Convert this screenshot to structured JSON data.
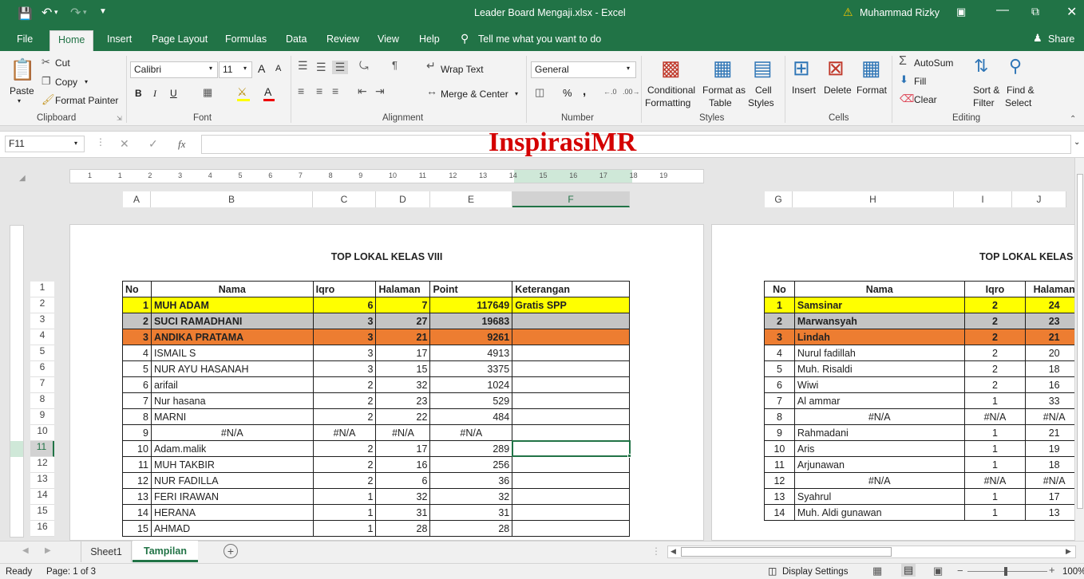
{
  "title": {
    "text": "Leader Board Mengaji.xlsx - Excel",
    "user": "Muhammad Rizky"
  },
  "tabs": [
    "File",
    "Home",
    "Insert",
    "Page Layout",
    "Formulas",
    "Data",
    "Review",
    "View",
    "Help"
  ],
  "tell_me": "Tell me what you want to do",
  "share": "Share",
  "clipboard": {
    "paste": "Paste",
    "cut": "Cut",
    "copy": "Copy",
    "format_painter": "Format Painter",
    "label": "Clipboard"
  },
  "font": {
    "name": "Calibri",
    "size": "11",
    "label": "Font",
    "bold": "B",
    "italic": "I",
    "underline": "U",
    "grow": "A",
    "shrink": "A"
  },
  "alignment": {
    "wrap": "Wrap Text",
    "merge": "Merge & Center",
    "label": "Alignment"
  },
  "number": {
    "format": "General",
    "label": "Number",
    "percent": "%",
    "comma": ","
  },
  "styles": {
    "conditional": "Conditional",
    "formatting": "Formatting",
    "format_as": "Format as",
    "table": "Table",
    "cell": "Cell",
    "cell_styles": "Styles",
    "label": "Styles"
  },
  "cells": {
    "insert": "Insert",
    "delete": "Delete",
    "format": "Format",
    "label": "Cells"
  },
  "editing": {
    "autosum": "AutoSum",
    "fill": "Fill",
    "clear": "Clear",
    "sort": "Sort &",
    "filter": "Filter",
    "find": "Find &",
    "select": "Select",
    "label": "Editing"
  },
  "formula": {
    "namebox": "F11",
    "fx": "fx",
    "watermark": "InspirasiMR"
  },
  "ruler_numbers": [
    "1",
    "1",
    "2",
    "3",
    "4",
    "5",
    "6",
    "7",
    "8",
    "9",
    "10",
    "11",
    "12",
    "13",
    "14",
    "15",
    "16",
    "17",
    "18",
    "19"
  ],
  "col_headers_left": [
    "A",
    "B",
    "C",
    "D",
    "E",
    "F"
  ],
  "col_headers_right": [
    "G",
    "H",
    "I",
    "J"
  ],
  "row_numbers": [
    "1",
    "2",
    "3",
    "4",
    "5",
    "6",
    "7",
    "8",
    "9",
    "10",
    "11",
    "12",
    "13",
    "14",
    "15",
    "16"
  ],
  "page1": {
    "title": "TOP LOKAL KELAS VIII",
    "headers": [
      "No",
      "Nama",
      "Iqro",
      "Halaman",
      "Point",
      "Keterangan"
    ],
    "rows": [
      [
        "1",
        "MUH ADAM",
        "6",
        "7",
        "117649",
        "Gratis SPP"
      ],
      [
        "2",
        "SUCI RAMADHANI",
        "3",
        "27",
        "19683",
        ""
      ],
      [
        "3",
        "ANDIKA PRATAMA",
        "3",
        "21",
        "9261",
        ""
      ],
      [
        "4",
        "ISMAIL S",
        "3",
        "17",
        "4913",
        ""
      ],
      [
        "5",
        "NUR AYU HASANAH",
        "3",
        "15",
        "3375",
        ""
      ],
      [
        "6",
        "arifail",
        "2",
        "32",
        "1024",
        ""
      ],
      [
        "7",
        "Nur hasana",
        "2",
        "23",
        "529",
        ""
      ],
      [
        "8",
        "MARNI",
        "2",
        "22",
        "484",
        ""
      ],
      [
        "9",
        "#N/A",
        "#N/A",
        "#N/A",
        "#N/A",
        ""
      ],
      [
        "10",
        "Adam.malik",
        "2",
        "17",
        "289",
        ""
      ],
      [
        "11",
        "MUH TAKBIR",
        "2",
        "16",
        "256",
        ""
      ],
      [
        "12",
        "NUR FADILLA",
        "2",
        "6",
        "36",
        ""
      ],
      [
        "13",
        "FERI IRAWAN",
        "1",
        "32",
        "32",
        ""
      ],
      [
        "14",
        "HERANA",
        "1",
        "31",
        "31",
        ""
      ],
      [
        "15",
        "AHMAD",
        "1",
        "28",
        "28",
        ""
      ]
    ]
  },
  "page2": {
    "title": "TOP LOKAL KELAS IX",
    "headers": [
      "No",
      "Nama",
      "Iqro",
      "Halaman"
    ],
    "rows": [
      [
        "1",
        "Samsinar",
        "2",
        "24"
      ],
      [
        "2",
        "Marwansyah",
        "2",
        "23"
      ],
      [
        "3",
        "Lindah",
        "2",
        "21"
      ],
      [
        "4",
        "Nurul fadillah",
        "2",
        "20"
      ],
      [
        "5",
        "Muh. Risaldi",
        "2",
        "18"
      ],
      [
        "6",
        "Wiwi",
        "2",
        "16"
      ],
      [
        "7",
        "Al ammar",
        "1",
        "33"
      ],
      [
        "8",
        "#N/A",
        "#N/A",
        "#N/A"
      ],
      [
        "9",
        "Rahmadani",
        "1",
        "21"
      ],
      [
        "10",
        "Aris",
        "1",
        "19"
      ],
      [
        "11",
        "Arjunawan",
        "1",
        "18"
      ],
      [
        "12",
        "#N/A",
        "#N/A",
        "#N/A"
      ],
      [
        "13",
        "Syahrul",
        "1",
        "17"
      ],
      [
        "14",
        "Muh. Aldi gunawan",
        "1",
        "13"
      ]
    ]
  },
  "sheets": [
    "Sheet1",
    "Tampilan"
  ],
  "status": {
    "ready": "Ready",
    "page": "Page: 1 of 3",
    "display": "Display Settings",
    "zoom": "100%"
  },
  "colors": {
    "accent": "#217346",
    "yellow": "#ffff00",
    "gray": "#c4c4c4",
    "orange": "#ed7d31",
    "watermark": "#d40000"
  }
}
